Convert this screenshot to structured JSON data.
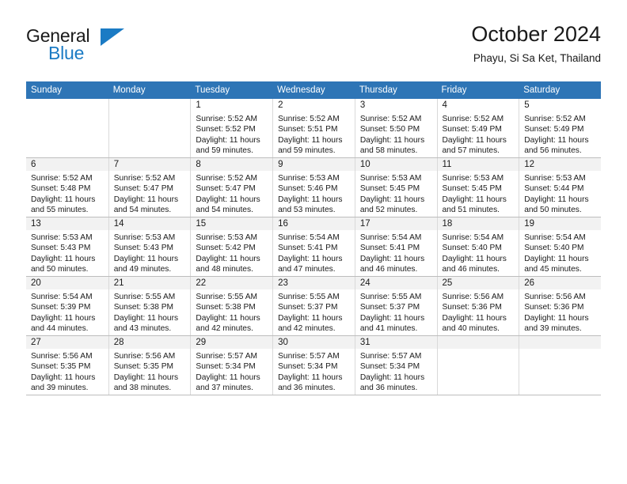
{
  "brand": {
    "name_part1": "General",
    "name_part2": "Blue",
    "triangle_icon": "triangle-icon",
    "accent_color": "#1b7bc4"
  },
  "header": {
    "month_title": "October 2024",
    "location": "Phayu, Si Sa Ket, Thailand"
  },
  "calendar": {
    "header_bg_color": "#2e75b6",
    "weekday_headers": [
      "Sunday",
      "Monday",
      "Tuesday",
      "Wednesday",
      "Thursday",
      "Friday",
      "Saturday"
    ],
    "weeks": [
      {
        "shaded": false,
        "days": [
          {
            "num": "",
            "lines": [
              "",
              "",
              "",
              ""
            ]
          },
          {
            "num": "",
            "lines": [
              "",
              "",
              "",
              ""
            ]
          },
          {
            "num": "1",
            "lines": [
              "Sunrise: 5:52 AM",
              "Sunset: 5:52 PM",
              "Daylight: 11 hours",
              "and 59 minutes."
            ]
          },
          {
            "num": "2",
            "lines": [
              "Sunrise: 5:52 AM",
              "Sunset: 5:51 PM",
              "Daylight: 11 hours",
              "and 59 minutes."
            ]
          },
          {
            "num": "3",
            "lines": [
              "Sunrise: 5:52 AM",
              "Sunset: 5:50 PM",
              "Daylight: 11 hours",
              "and 58 minutes."
            ]
          },
          {
            "num": "4",
            "lines": [
              "Sunrise: 5:52 AM",
              "Sunset: 5:49 PM",
              "Daylight: 11 hours",
              "and 57 minutes."
            ]
          },
          {
            "num": "5",
            "lines": [
              "Sunrise: 5:52 AM",
              "Sunset: 5:49 PM",
              "Daylight: 11 hours",
              "and 56 minutes."
            ]
          }
        ]
      },
      {
        "shaded": true,
        "days": [
          {
            "num": "6",
            "lines": [
              "Sunrise: 5:52 AM",
              "Sunset: 5:48 PM",
              "Daylight: 11 hours",
              "and 55 minutes."
            ]
          },
          {
            "num": "7",
            "lines": [
              "Sunrise: 5:52 AM",
              "Sunset: 5:47 PM",
              "Daylight: 11 hours",
              "and 54 minutes."
            ]
          },
          {
            "num": "8",
            "lines": [
              "Sunrise: 5:52 AM",
              "Sunset: 5:47 PM",
              "Daylight: 11 hours",
              "and 54 minutes."
            ]
          },
          {
            "num": "9",
            "lines": [
              "Sunrise: 5:53 AM",
              "Sunset: 5:46 PM",
              "Daylight: 11 hours",
              "and 53 minutes."
            ]
          },
          {
            "num": "10",
            "lines": [
              "Sunrise: 5:53 AM",
              "Sunset: 5:45 PM",
              "Daylight: 11 hours",
              "and 52 minutes."
            ]
          },
          {
            "num": "11",
            "lines": [
              "Sunrise: 5:53 AM",
              "Sunset: 5:45 PM",
              "Daylight: 11 hours",
              "and 51 minutes."
            ]
          },
          {
            "num": "12",
            "lines": [
              "Sunrise: 5:53 AM",
              "Sunset: 5:44 PM",
              "Daylight: 11 hours",
              "and 50 minutes."
            ]
          }
        ]
      },
      {
        "shaded": true,
        "days": [
          {
            "num": "13",
            "lines": [
              "Sunrise: 5:53 AM",
              "Sunset: 5:43 PM",
              "Daylight: 11 hours",
              "and 50 minutes."
            ]
          },
          {
            "num": "14",
            "lines": [
              "Sunrise: 5:53 AM",
              "Sunset: 5:43 PM",
              "Daylight: 11 hours",
              "and 49 minutes."
            ]
          },
          {
            "num": "15",
            "lines": [
              "Sunrise: 5:53 AM",
              "Sunset: 5:42 PM",
              "Daylight: 11 hours",
              "and 48 minutes."
            ]
          },
          {
            "num": "16",
            "lines": [
              "Sunrise: 5:54 AM",
              "Sunset: 5:41 PM",
              "Daylight: 11 hours",
              "and 47 minutes."
            ]
          },
          {
            "num": "17",
            "lines": [
              "Sunrise: 5:54 AM",
              "Sunset: 5:41 PM",
              "Daylight: 11 hours",
              "and 46 minutes."
            ]
          },
          {
            "num": "18",
            "lines": [
              "Sunrise: 5:54 AM",
              "Sunset: 5:40 PM",
              "Daylight: 11 hours",
              "and 46 minutes."
            ]
          },
          {
            "num": "19",
            "lines": [
              "Sunrise: 5:54 AM",
              "Sunset: 5:40 PM",
              "Daylight: 11 hours",
              "and 45 minutes."
            ]
          }
        ]
      },
      {
        "shaded": true,
        "days": [
          {
            "num": "20",
            "lines": [
              "Sunrise: 5:54 AM",
              "Sunset: 5:39 PM",
              "Daylight: 11 hours",
              "and 44 minutes."
            ]
          },
          {
            "num": "21",
            "lines": [
              "Sunrise: 5:55 AM",
              "Sunset: 5:38 PM",
              "Daylight: 11 hours",
              "and 43 minutes."
            ]
          },
          {
            "num": "22",
            "lines": [
              "Sunrise: 5:55 AM",
              "Sunset: 5:38 PM",
              "Daylight: 11 hours",
              "and 42 minutes."
            ]
          },
          {
            "num": "23",
            "lines": [
              "Sunrise: 5:55 AM",
              "Sunset: 5:37 PM",
              "Daylight: 11 hours",
              "and 42 minutes."
            ]
          },
          {
            "num": "24",
            "lines": [
              "Sunrise: 5:55 AM",
              "Sunset: 5:37 PM",
              "Daylight: 11 hours",
              "and 41 minutes."
            ]
          },
          {
            "num": "25",
            "lines": [
              "Sunrise: 5:56 AM",
              "Sunset: 5:36 PM",
              "Daylight: 11 hours",
              "and 40 minutes."
            ]
          },
          {
            "num": "26",
            "lines": [
              "Sunrise: 5:56 AM",
              "Sunset: 5:36 PM",
              "Daylight: 11 hours",
              "and 39 minutes."
            ]
          }
        ]
      },
      {
        "shaded": true,
        "days": [
          {
            "num": "27",
            "lines": [
              "Sunrise: 5:56 AM",
              "Sunset: 5:35 PM",
              "Daylight: 11 hours",
              "and 39 minutes."
            ]
          },
          {
            "num": "28",
            "lines": [
              "Sunrise: 5:56 AM",
              "Sunset: 5:35 PM",
              "Daylight: 11 hours",
              "and 38 minutes."
            ]
          },
          {
            "num": "29",
            "lines": [
              "Sunrise: 5:57 AM",
              "Sunset: 5:34 PM",
              "Daylight: 11 hours",
              "and 37 minutes."
            ]
          },
          {
            "num": "30",
            "lines": [
              "Sunrise: 5:57 AM",
              "Sunset: 5:34 PM",
              "Daylight: 11 hours",
              "and 36 minutes."
            ]
          },
          {
            "num": "31",
            "lines": [
              "Sunrise: 5:57 AM",
              "Sunset: 5:34 PM",
              "Daylight: 11 hours",
              "and 36 minutes."
            ]
          },
          {
            "num": "",
            "lines": [
              "",
              "",
              "",
              ""
            ]
          },
          {
            "num": "",
            "lines": [
              "",
              "",
              "",
              ""
            ]
          }
        ]
      }
    ]
  }
}
